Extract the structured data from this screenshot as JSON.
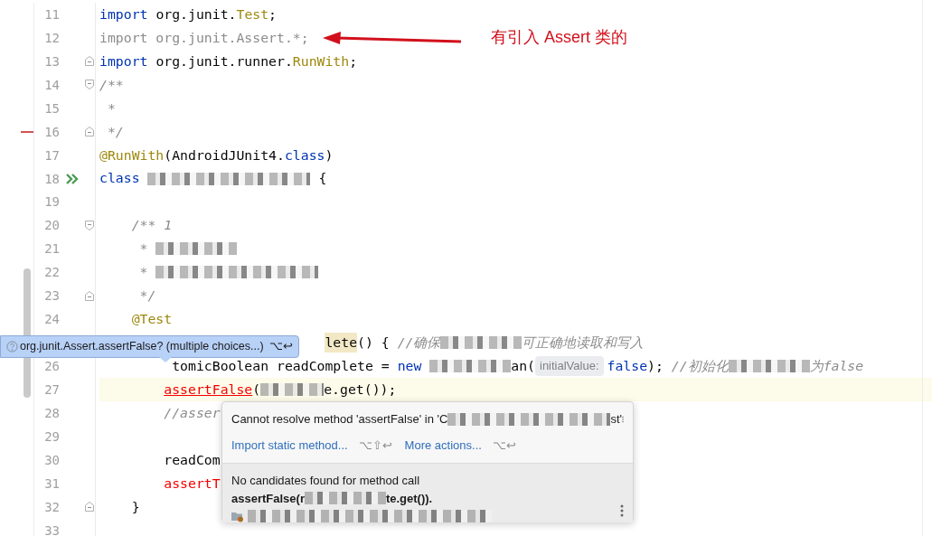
{
  "annotation": {
    "text": "有引入 Assert 类的"
  },
  "lines": [
    {
      "number": "11",
      "current": false,
      "tokens": [
        {
          "kind": "keyword",
          "text": "import"
        },
        {
          "kind": "plain",
          "text": " org.junit."
        },
        {
          "kind": "type",
          "text": "Test"
        },
        {
          "kind": "plain",
          "text": ";"
        }
      ]
    },
    {
      "number": "12",
      "current": false,
      "tokens": [
        {
          "kind": "unused",
          "text": "import org.junit.Assert.*;"
        }
      ]
    },
    {
      "number": "13",
      "current": false,
      "fold": {
        "kind": "end"
      },
      "tokens": [
        {
          "kind": "keyword",
          "text": "import"
        },
        {
          "kind": "plain",
          "text": " org.junit.runner."
        },
        {
          "kind": "type",
          "text": "RunWith"
        },
        {
          "kind": "plain",
          "text": ";"
        }
      ]
    },
    {
      "number": "14",
      "current": false,
      "fold": {
        "kind": "start"
      },
      "tokens": [
        {
          "kind": "comment",
          "text": "/**"
        }
      ]
    },
    {
      "number": "15",
      "current": false,
      "tokens": [
        {
          "kind": "comment",
          "text": " *"
        }
      ]
    },
    {
      "number": "16",
      "current": false,
      "fold": {
        "kind": "end"
      },
      "marker": {
        "kind": "change"
      },
      "tokens": [
        {
          "kind": "comment",
          "text": " */"
        }
      ]
    },
    {
      "number": "17",
      "current": false,
      "tokens": [
        {
          "kind": "type",
          "text": "@RunWith"
        },
        {
          "kind": "plain",
          "text": "(AndroidJUnit4."
        },
        {
          "kind": "keyword",
          "text": "class"
        },
        {
          "kind": "plain",
          "text": ")"
        }
      ]
    },
    {
      "number": "18",
      "current": false,
      "marker": {
        "kind": "run"
      },
      "tokens": [
        {
          "kind": "keyword",
          "text": "class "
        },
        {
          "kind": "redacted-l"
        },
        {
          "kind": "plain",
          "text": " {"
        }
      ]
    },
    {
      "number": "19",
      "current": false
    },
    {
      "number": "20",
      "current": false,
      "fold": {
        "kind": "start"
      },
      "tokens": [
        {
          "kind": "comment",
          "text": "    /** 1"
        }
      ]
    },
    {
      "number": "21",
      "current": false,
      "tokens": [
        {
          "kind": "comment",
          "text": "     * "
        },
        {
          "kind": "redacted-m"
        }
      ]
    },
    {
      "number": "22",
      "current": false,
      "tokens": [
        {
          "kind": "comment",
          "text": "     * "
        },
        {
          "kind": "redacted-l"
        }
      ]
    },
    {
      "number": "23",
      "current": false,
      "fold": {
        "kind": "end"
      },
      "tokens": [
        {
          "kind": "comment",
          "text": "     */"
        }
      ]
    },
    {
      "number": "24",
      "current": false,
      "tokens": [
        {
          "kind": "type",
          "text": "    @Test"
        }
      ]
    },
    {
      "current": false,
      "tokens": [
        {
          "kind": "usage",
          "text": "                            lete"
        },
        {
          "kind": "plain",
          "text": "() { "
        },
        {
          "kind": "comment",
          "text": "//确保"
        },
        {
          "kind": "redacted-m"
        },
        {
          "kind": "comment",
          "text": "可正确地读取和写入"
        }
      ]
    },
    {
      "number": "26",
      "current": false,
      "tokens": [
        {
          "kind": "plain",
          "text": "         tomicBoolean readComplete = "
        },
        {
          "kind": "keyword",
          "text": "new "
        },
        {
          "kind": "redacted-m"
        },
        {
          "kind": "plain",
          "text": "an("
        },
        {
          "kind": "hint",
          "text": "initialValue:"
        },
        {
          "kind": "keyword",
          "text": "false"
        },
        {
          "kind": "plain",
          "text": "); "
        },
        {
          "kind": "comment",
          "text": "//初始化"
        },
        {
          "kind": "redacted-m"
        },
        {
          "kind": "comment",
          "text": "为false"
        }
      ]
    },
    {
      "number": "27",
      "current": true,
      "tokens": [
        {
          "kind": "error",
          "text": "        assertFalse"
        },
        {
          "kind": "plain",
          "text": "("
        },
        {
          "kind": "redacted-s"
        },
        {
          "kind": "plain",
          "text": "e.get());"
        }
      ]
    },
    {
      "number": "28",
      "current": false,
      "tokens": [
        {
          "kind": "comment",
          "text": "        //asser"
        }
      ]
    },
    {
      "number": "29",
      "current": false
    },
    {
      "number": "30",
      "current": false,
      "tokens": [
        {
          "kind": "plain",
          "text": "        readCom"
        }
      ]
    },
    {
      "number": "31",
      "current": false,
      "tokens": [
        {
          "kind": "error-plain",
          "text": "        assertT"
        }
      ]
    },
    {
      "number": "32",
      "current": false,
      "fold": {
        "kind": "end"
      },
      "tokens": [
        {
          "kind": "plain",
          "text": "    }"
        }
      ]
    },
    {
      "number": "33",
      "current": false
    }
  ],
  "tooltip": {
    "text": "org.junit.Assert.assertFalse? (multiple choices...)",
    "shortcut": "⌥↩"
  },
  "popup": {
    "message": [
      {
        "kind": "text",
        "text": "Cannot resolve method 'assertFalse' in 'C"
      },
      {
        "kind": "redacted-l"
      },
      {
        "kind": "text",
        "text": "st'"
      }
    ],
    "actions": [
      {
        "label": "Import static method...",
        "shortcut": "⌥⇧↩"
      },
      {
        "label": "More actions...",
        "shortcut": "⌥↩"
      }
    ],
    "detail": "No candidates found for method call",
    "detail_code": [
      {
        "kind": "text",
        "text": "assertFalse(r"
      },
      {
        "kind": "redacted-m"
      },
      {
        "kind": "text",
        "text": "te.get())."
      }
    ],
    "source": [
      {
        "kind": "redacted-xl"
      }
    ]
  }
}
